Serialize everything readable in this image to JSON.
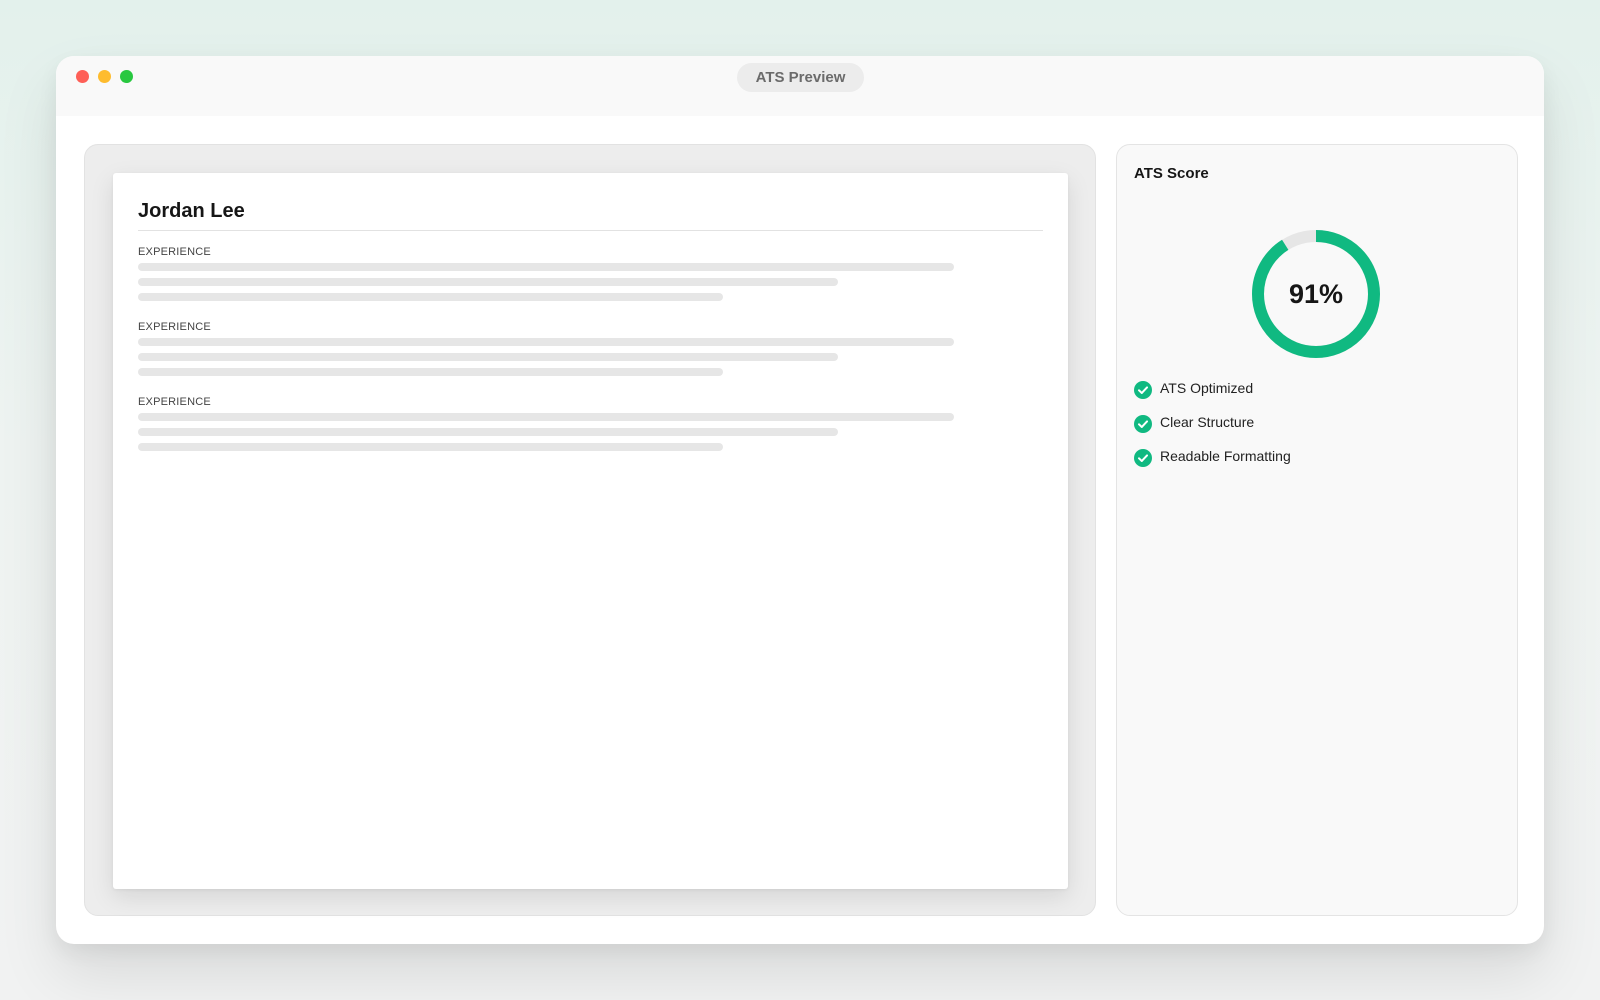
{
  "window": {
    "title": "ATS Preview"
  },
  "resume": {
    "name": "Jordan Lee",
    "sections": [
      {
        "label": "EXPERIENCE"
      },
      {
        "label": "EXPERIENCE"
      },
      {
        "label": "EXPERIENCE"
      }
    ]
  },
  "score_panel": {
    "title": "ATS Score",
    "score_value": 91,
    "score_text": "91%",
    "checks": [
      {
        "label": "ATS Optimized",
        "icon": "check-circle-icon"
      },
      {
        "label": "Clear Structure",
        "icon": "check-circle-icon"
      },
      {
        "label": "Readable Formatting",
        "icon": "check-circle-icon"
      }
    ]
  },
  "colors": {
    "accent": "#10b981",
    "ring_track": "#e6e6e6",
    "close": "#fe5f57",
    "minimize": "#febc2e",
    "maximize": "#28c840"
  }
}
